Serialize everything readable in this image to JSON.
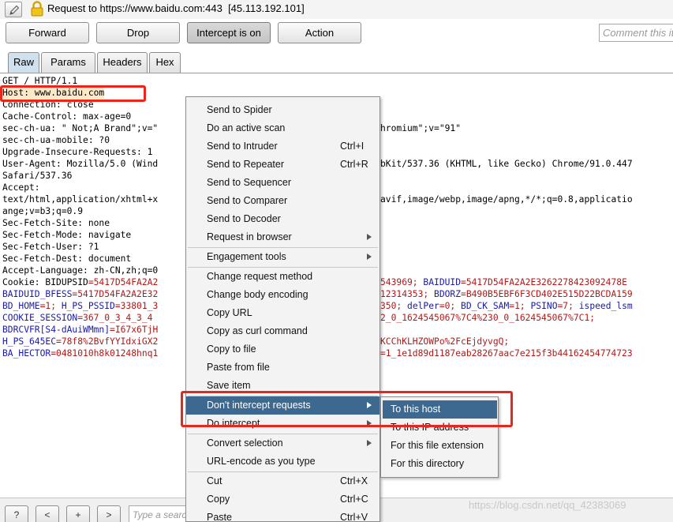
{
  "header": {
    "title": "Request to https://www.baidu.com:443  [45.113.192.101]",
    "edit_icon": "pencil-icon",
    "lock_icon": "lock-icon"
  },
  "toolbar": {
    "forward": "Forward",
    "drop": "Drop",
    "intercept": "Intercept is on",
    "action": "Action",
    "comment_placeholder": "Comment this it"
  },
  "tabs": [
    "Raw",
    "Params",
    "Headers",
    "Hex"
  ],
  "request": {
    "l1": "GET / HTTP/1.1",
    "l2": "Host: www.baidu.com",
    "l3": "Connection: close",
    "l4a": "Cache-Control: max-age=0",
    "l5a": "sec-ch-ua: \" Not;A Brand\";v=\"",
    "l5b": "hromium\";v=\"91\"",
    "l6a": "sec-ch-ua-mobile: ?0",
    "l7a": "Upgrade-Insecure-Requests: 1",
    "l8a": "User-Agent: Mozilla/5.0 (Wind",
    "l8b": "bKit/537.36 (KHTML, like Gecko) Chrome/91.0.447",
    "l9a": "Safari/537.36",
    "l10a": "Accept:",
    "l11a": "text/html,application/xhtml+x",
    "l11b": "avif,image/webp,image/apng,*/*;q=0.8,applicatio",
    "l12a": "ange;v=b3;q=0.9",
    "l13a": "Sec-Fetch-Site: none",
    "l14a": "Sec-Fetch-Mode: navigate",
    "l15a": "Sec-Fetch-User: ?1",
    "l16a": "Sec-Fetch-Dest: document",
    "l17a": "Accept-Language: zh-CN,zh;q=0",
    "l18_k1": "Cookie: BIDUPSID",
    "l18_v1": "=5417D54FA2A2",
    "l18_v2": "543969; ",
    "l18_k2": "BAIDUID",
    "l18_v3": "=5417D54FA2A2E3262278423092478E",
    "l19_k1": "BAIDUID_BFESS",
    "l19_v1": "=5417D54FA2A2E32",
    "l19_v2": "12314353; ",
    "l19_k2": "BDORZ",
    "l19_v3": "=B490B5EBF6F3CD402E515D22BCDA159",
    "l20_k1": "BD_HOME",
    "l20_v1": "=1; ",
    "l20_k2": "H_PS_PSSID",
    "l20_v2": "=33801_3",
    "l20_v3": "350; ",
    "l20_k3": "delPer",
    "l20_v4": "=0; ",
    "l20_k4": "BD_CK_SAM",
    "l20_v5": "=1; ",
    "l20_k5": "PSINO",
    "l20_v6": "=7; ",
    "l20_k6": "ispeed_lsm",
    "l21_k1": "COOKIE_SESSION",
    "l21_v1": "=367_0_3_4_3_4",
    "l21_v2": "2_0_1624545067%7C4%230_0_1624545067%7C1;",
    "l22_k1": "BDRCVFR[S4-dAuiWMmn]",
    "l22_v1": "=I67x6TjH",
    "l23_k1": "H_PS_645EC",
    "l23_v1": "=78f8%2BvfYYIdxiGX2",
    "l23_v2": "KCChKLHZOWPo%2FcEjdyvgQ;",
    "l24_k1": "BA_HECTOR",
    "l24_v1": "=0481010h8k01248hnq1",
    "l24_v2": "=1_1e1d89d1187eab28267aac7e215f3b44162454774723"
  },
  "context_menu": {
    "items": [
      {
        "label": "Send to Spider",
        "shortcut": ""
      },
      {
        "label": "Do an active scan",
        "shortcut": ""
      },
      {
        "label": "Send to Intruder",
        "shortcut": "Ctrl+I"
      },
      {
        "label": "Send to Repeater",
        "shortcut": "Ctrl+R"
      },
      {
        "label": "Send to Sequencer",
        "shortcut": ""
      },
      {
        "label": "Send to Comparer",
        "shortcut": ""
      },
      {
        "label": "Send to Decoder",
        "shortcut": ""
      },
      {
        "label": "Request in browser",
        "shortcut": ""
      },
      {
        "label": "Engagement tools",
        "shortcut": ""
      },
      {
        "label": "Change request method",
        "shortcut": ""
      },
      {
        "label": "Change body encoding",
        "shortcut": ""
      },
      {
        "label": "Copy URL",
        "shortcut": ""
      },
      {
        "label": "Copy as curl command",
        "shortcut": ""
      },
      {
        "label": "Copy to file",
        "shortcut": ""
      },
      {
        "label": "Paste from file",
        "shortcut": ""
      },
      {
        "label": "Save item",
        "shortcut": ""
      },
      {
        "label": "Don't intercept requests",
        "shortcut": ""
      },
      {
        "label": "Do intercept",
        "shortcut": ""
      },
      {
        "label": "Convert selection",
        "shortcut": ""
      },
      {
        "label": "URL-encode as you type",
        "shortcut": ""
      },
      {
        "label": "Cut",
        "shortcut": "Ctrl+X"
      },
      {
        "label": "Copy",
        "shortcut": "Ctrl+C"
      },
      {
        "label": "Paste",
        "shortcut": "Ctrl+V"
      }
    ]
  },
  "submenu": {
    "items": [
      "To this host",
      "To this IP address",
      "For this file extension",
      "For this directory"
    ]
  },
  "bottom": {
    "help": "?",
    "prev": "<",
    "add": "+",
    "next": ">",
    "search_placeholder": "Type a search"
  },
  "watermark": "https://blog.csdn.net/qq_42383069",
  "colors": {
    "menu_highlight": "#3d6990",
    "annotation_red": "#e8261b",
    "cookie_key": "#1a1aa6",
    "cookie_value": "#b01818"
  }
}
